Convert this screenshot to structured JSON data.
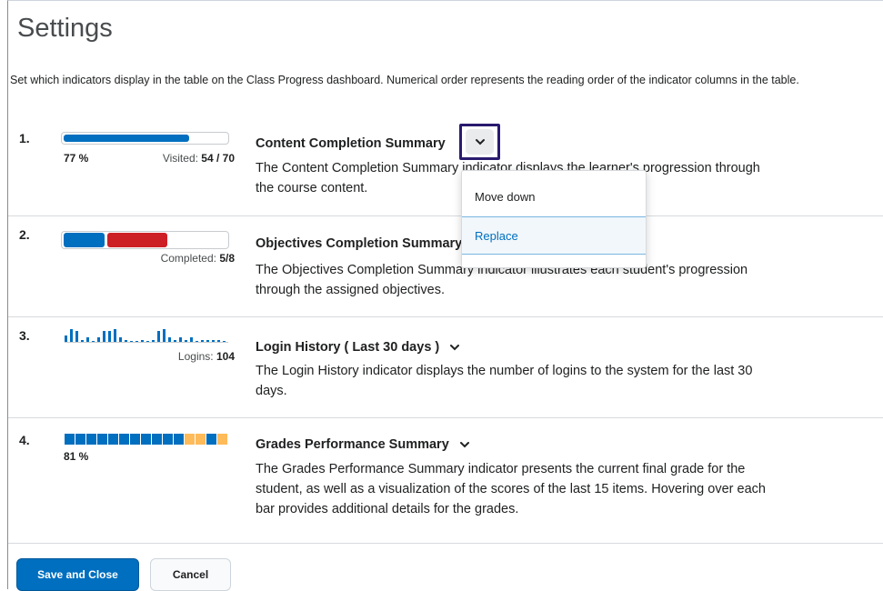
{
  "page": {
    "title": "Settings",
    "description": "Set which indicators display in the table on the Class Progress dashboard. Numerical order represents the reading order of the indicator columns in the table."
  },
  "indicators": [
    {
      "number": "1.",
      "title": "Content Completion Summary",
      "description": "The Content Completion Summary indicator displays the learner's progression through the course content.",
      "percent_label": "77 %",
      "progress": 0.77,
      "visited_label": "Visited:",
      "visited_value": "54 / 70"
    },
    {
      "number": "2.",
      "title": "Objectives Completion Summary",
      "description": "The Objectives Completion Summary indicator illustrates each student's progression through the assigned objectives.",
      "completed_label": "Completed:",
      "completed_value": "5/8"
    },
    {
      "number": "3.",
      "title": "Login History ( Last 30 days )",
      "description": "The Login History indicator displays the number of logins to the system for the last 30 days.",
      "logins_label": "Logins:",
      "logins_value": "104",
      "daily_logins": [
        3,
        6,
        5,
        1,
        2,
        0,
        2,
        5,
        5,
        6,
        2,
        1,
        0,
        0,
        1,
        0,
        1,
        5,
        6,
        2,
        1,
        2,
        1,
        2,
        0,
        1,
        1,
        1,
        1,
        0
      ]
    },
    {
      "number": "4.",
      "title": "Grades Performance Summary",
      "description": "The Grades Performance Summary indicator presents the current final grade for the student, as well as a visualization of the scores of the last 15 items. Hovering over each bar provides additional details for the grades.",
      "percent_label": "81 %"
    }
  ],
  "menu": {
    "items": [
      "Move down",
      "Replace"
    ],
    "selected": "Replace"
  },
  "footer": {
    "save_label": "Save and Close",
    "cancel_label": "Cancel"
  },
  "colors": {
    "primary": "#006fbf",
    "red": "#cd2026",
    "amber": "#ffba59",
    "focus": "#2a1a6e"
  }
}
